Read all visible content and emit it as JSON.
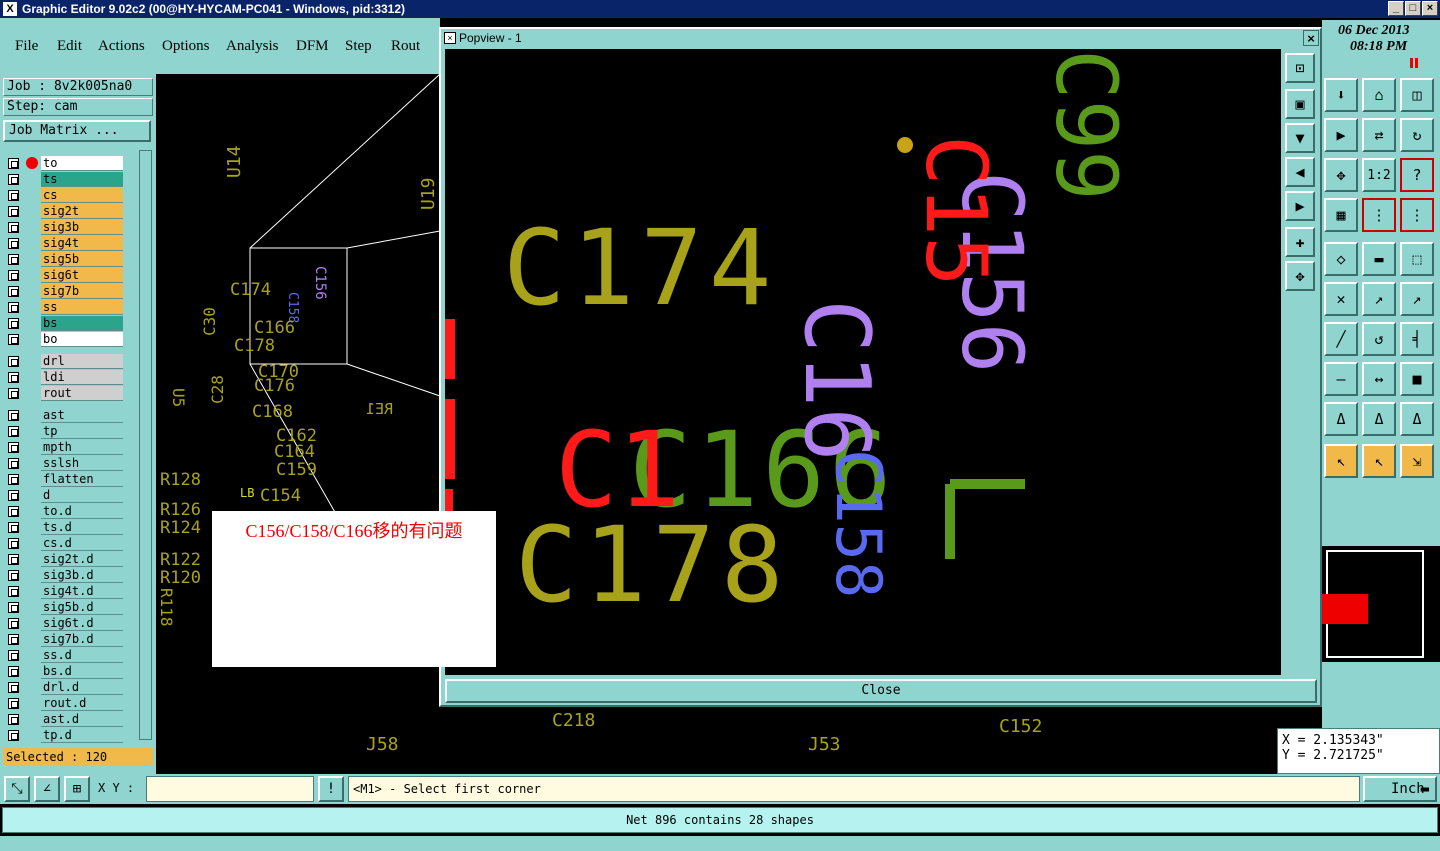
{
  "window": {
    "title": "Graphic Editor 9.02c2 (00@HY-HYCAM-PC041 - Windows, pid:3312)",
    "app_icon": "X",
    "buttons": {
      "minimize": "_",
      "maximize": "□",
      "close": "×"
    }
  },
  "menu": [
    "File",
    "Edit",
    "Actions",
    "Options",
    "Analysis",
    "DFM",
    "Step",
    "Rout"
  ],
  "job": {
    "job_label": "Job : 8v2k005na0",
    "step_label": "Step: cam",
    "matrix_button": "Job Matrix ..."
  },
  "layers": {
    "board": [
      {
        "name": "to",
        "color": "#ffffff",
        "active": true
      },
      {
        "name": "ts",
        "color": "#2aa58c"
      },
      {
        "name": "cs",
        "color": "#f0b94a"
      },
      {
        "name": "sig2t",
        "color": "#f0b94a"
      },
      {
        "name": "sig3b",
        "color": "#f0b94a"
      },
      {
        "name": "sig4t",
        "color": "#f0b94a"
      },
      {
        "name": "sig5b",
        "color": "#f0b94a"
      },
      {
        "name": "sig6t",
        "color": "#f0b94a"
      },
      {
        "name": "sig7b",
        "color": "#f0b94a"
      },
      {
        "name": "ss",
        "color": "#f0b94a"
      },
      {
        "name": "bs",
        "color": "#2aa58c"
      },
      {
        "name": "bo",
        "color": "#ffffff"
      }
    ],
    "drill": [
      {
        "name": "drl",
        "color": "#cfcfcf"
      },
      {
        "name": "ldi",
        "color": "#cfcfcf"
      },
      {
        "name": "rout",
        "color": "#cfcfcf"
      }
    ],
    "misc": [
      {
        "name": "ast",
        "color": "#8fd4cf"
      },
      {
        "name": "tp",
        "color": "#8fd4cf"
      },
      {
        "name": "mpth",
        "color": "#8fd4cf"
      },
      {
        "name": "sslsh",
        "color": "#8fd4cf"
      },
      {
        "name": "flatten",
        "color": "#8fd4cf"
      },
      {
        "name": "d",
        "color": "#8fd4cf"
      },
      {
        "name": "to.d",
        "color": "#8fd4cf"
      },
      {
        "name": "ts.d",
        "color": "#8fd4cf"
      },
      {
        "name": "cs.d",
        "color": "#8fd4cf"
      },
      {
        "name": "sig2t.d",
        "color": "#8fd4cf"
      },
      {
        "name": "sig3b.d",
        "color": "#8fd4cf"
      },
      {
        "name": "sig4t.d",
        "color": "#8fd4cf"
      },
      {
        "name": "sig5b.d",
        "color": "#8fd4cf"
      },
      {
        "name": "sig6t.d",
        "color": "#8fd4cf"
      },
      {
        "name": "sig7b.d",
        "color": "#8fd4cf"
      },
      {
        "name": "ss.d",
        "color": "#8fd4cf"
      },
      {
        "name": "bs.d",
        "color": "#8fd4cf"
      },
      {
        "name": "drl.d",
        "color": "#8fd4cf"
      },
      {
        "name": "rout.d",
        "color": "#8fd4cf"
      },
      {
        "name": "ast.d",
        "color": "#8fd4cf"
      },
      {
        "name": "tp.d",
        "color": "#8fd4cf"
      }
    ]
  },
  "selected": "Selected : 120",
  "popview": {
    "title": "Popview - 1",
    "close_label": "Close",
    "labels": [
      "C174",
      "C178",
      "C166",
      "C158",
      "C156",
      "C15",
      "C16",
      "C1",
      "C99"
    ]
  },
  "main_canvas": {
    "labels": [
      "U14",
      "U19",
      "C30",
      "C174",
      "C156",
      "C158",
      "C166",
      "C178",
      "C170",
      "C176",
      "C168",
      "C162",
      "C164",
      "C159",
      "C154",
      "U5",
      "C28",
      "R128",
      "R126",
      "R124",
      "R122",
      "R120",
      "R118",
      "C218",
      "C152",
      "J58",
      "J53",
      "RE1",
      "LB"
    ]
  },
  "note": {
    "text": "C156/C158/C166移的有问题",
    "color": "#e00000"
  },
  "clock": {
    "date": "06 Dec 2013",
    "time": "08:18 PM"
  },
  "coords": {
    "x": "X = 2.135343\"",
    "y": "Y = 2.721725\""
  },
  "bottom": {
    "xy_label": "X Y :",
    "xy_value": "",
    "prompt": "<M1> - Select first corner",
    "unit": "Inch"
  },
  "status": "Net 896 contains 28 shapes",
  "colors": {
    "panel": "#8fd4cf",
    "silk": "#a8a21a",
    "green": "#5a9a1a",
    "red": "#ff1a1a",
    "purple": "#b080f0",
    "blue": "#5a6af0"
  }
}
